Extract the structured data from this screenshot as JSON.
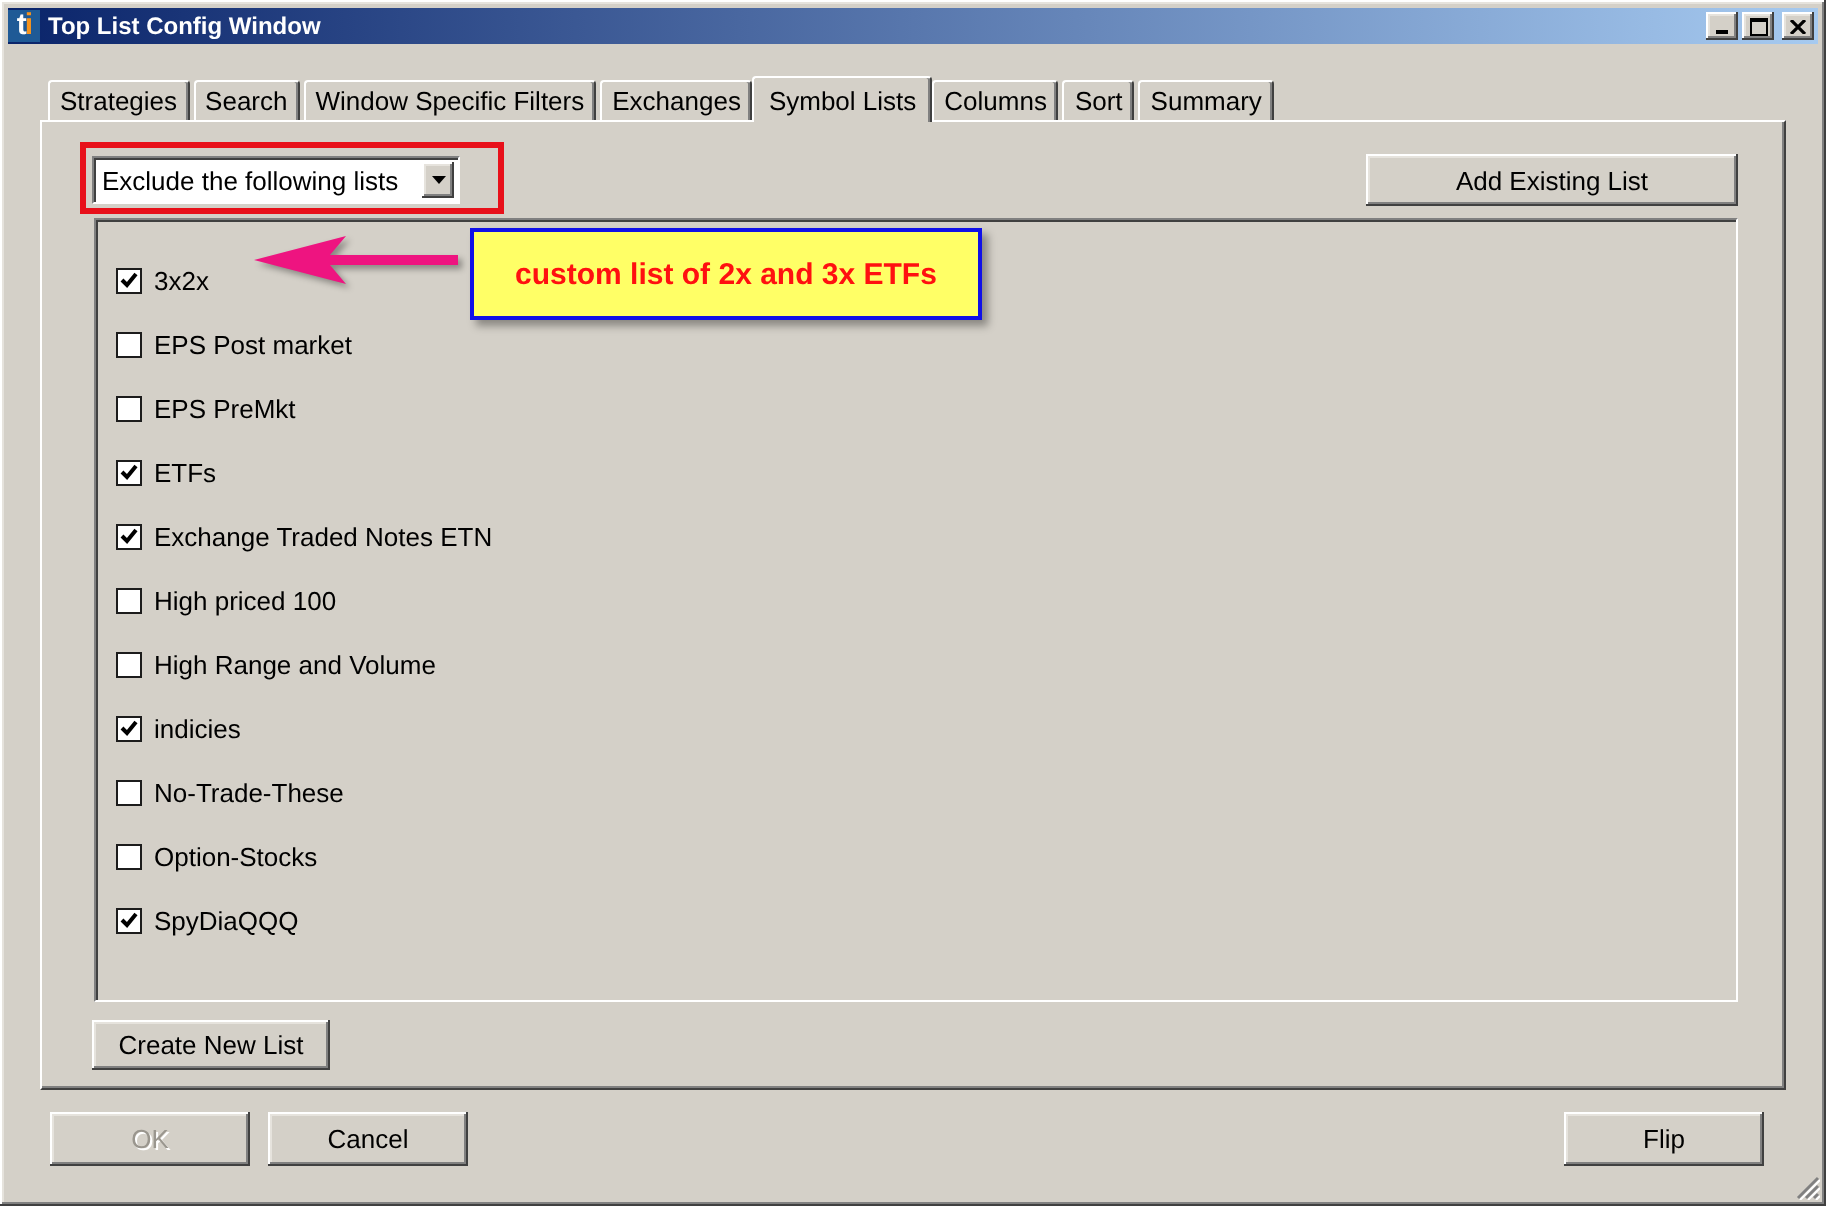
{
  "window": {
    "logo": "ti",
    "title": "Top List Config Window"
  },
  "tabs": [
    {
      "label": "Strategies",
      "selected": false
    },
    {
      "label": "Search",
      "selected": false
    },
    {
      "label": "Window Specific Filters",
      "selected": false
    },
    {
      "label": "Exchanges",
      "selected": false
    },
    {
      "label": "Symbol Lists",
      "selected": true
    },
    {
      "label": "Columns",
      "selected": false
    },
    {
      "label": "Sort",
      "selected": false
    },
    {
      "label": "Summary",
      "selected": false
    }
  ],
  "list_mode": {
    "value": "Exclude the following lists"
  },
  "add_button": "Add Existing List",
  "symbol_lists": [
    {
      "label": "3x2x",
      "checked": true
    },
    {
      "label": "EPS Post market",
      "checked": false
    },
    {
      "label": "EPS PreMkt",
      "checked": false
    },
    {
      "label": "ETFs",
      "checked": true
    },
    {
      "label": "Exchange Traded Notes ETN",
      "checked": true
    },
    {
      "label": "High priced 100",
      "checked": false
    },
    {
      "label": "High Range and Volume",
      "checked": false
    },
    {
      "label": "indicies",
      "checked": true
    },
    {
      "label": "No-Trade-These",
      "checked": false
    },
    {
      "label": "Option-Stocks",
      "checked": false
    },
    {
      "label": "SpyDiaQQQ",
      "checked": true
    }
  ],
  "create_button": "Create New List",
  "annotation": {
    "text": "custom list of 2x and 3x ETFs"
  },
  "footer_buttons": [
    {
      "label": "OK",
      "disabled": true
    },
    {
      "label": "Cancel",
      "disabled": false
    },
    {
      "label": "Flip",
      "disabled": false
    }
  ]
}
